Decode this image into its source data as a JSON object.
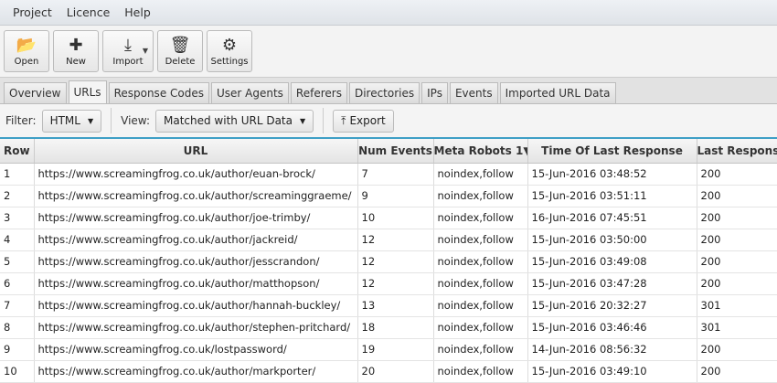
{
  "menu": [
    "Project",
    "Licence",
    "Help"
  ],
  "toolbar": [
    {
      "label": "Open",
      "icon": "folder-open-icon",
      "glyph": "📂"
    },
    {
      "label": "New",
      "icon": "plus-icon",
      "glyph": "✚"
    },
    {
      "label": "Import",
      "icon": "download-icon",
      "glyph": "⤓"
    },
    {
      "label": "Delete",
      "icon": "trash-icon",
      "glyph": "🗑"
    },
    {
      "label": "Settings",
      "icon": "gear-icon",
      "glyph": "⚙"
    }
  ],
  "tabs": [
    "Overview",
    "URLs",
    "Response Codes",
    "User Agents",
    "Referers",
    "Directories",
    "IPs",
    "Events",
    "Imported URL Data"
  ],
  "active_tab": "URLs",
  "filter": {
    "label": "Filter:",
    "value": "HTML"
  },
  "view": {
    "label": "View:",
    "value": "Matched with URL Data"
  },
  "export_label": "Export",
  "table": {
    "columns": [
      "Row",
      "URL",
      "Num Events",
      "Meta Robots 1▼",
      "Time Of Last Response",
      "Last Response"
    ],
    "rows": [
      [
        "1",
        "https://www.screamingfrog.co.uk/author/euan-brock/",
        "7",
        "noindex,follow",
        "15-Jun-2016 03:48:52",
        "200"
      ],
      [
        "2",
        "https://www.screamingfrog.co.uk/author/screaminggraeme/",
        "9",
        "noindex,follow",
        "15-Jun-2016 03:51:11",
        "200"
      ],
      [
        "3",
        "https://www.screamingfrog.co.uk/author/joe-trimby/",
        "10",
        "noindex,follow",
        "16-Jun-2016 07:45:51",
        "200"
      ],
      [
        "4",
        "https://www.screamingfrog.co.uk/author/jackreid/",
        "12",
        "noindex,follow",
        "15-Jun-2016 03:50:00",
        "200"
      ],
      [
        "5",
        "https://www.screamingfrog.co.uk/author/jesscrandon/",
        "12",
        "noindex,follow",
        "15-Jun-2016 03:49:08",
        "200"
      ],
      [
        "6",
        "https://www.screamingfrog.co.uk/author/matthopson/",
        "12",
        "noindex,follow",
        "15-Jun-2016 03:47:28",
        "200"
      ],
      [
        "7",
        "https://www.screamingfrog.co.uk/author/hannah-buckley/",
        "13",
        "noindex,follow",
        "15-Jun-2016 20:32:27",
        "301"
      ],
      [
        "8",
        "https://www.screamingfrog.co.uk/author/stephen-pritchard/",
        "18",
        "noindex,follow",
        "15-Jun-2016 03:46:46",
        "301"
      ],
      [
        "9",
        "https://www.screamingfrog.co.uk/lostpassword/",
        "19",
        "noindex,follow",
        "14-Jun-2016 08:56:32",
        "200"
      ],
      [
        "10",
        "https://www.screamingfrog.co.uk/author/markporter/",
        "20",
        "noindex,follow",
        "15-Jun-2016 03:49:10",
        "200"
      ]
    ]
  }
}
